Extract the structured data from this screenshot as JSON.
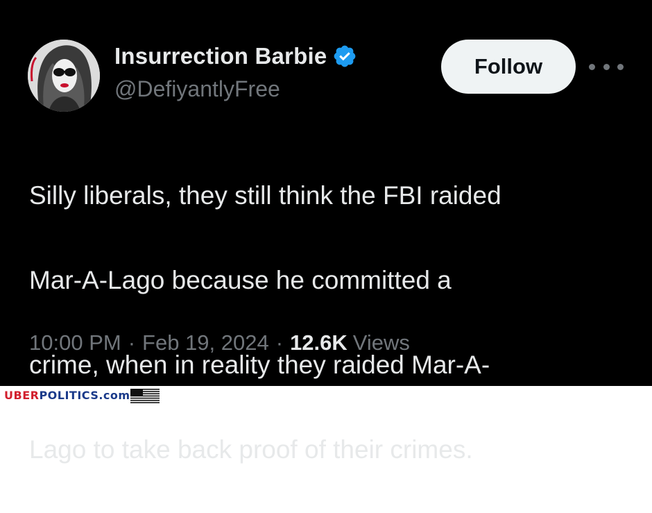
{
  "tweet": {
    "display_name": "Insurrection Barbie",
    "handle": "@DefiyantlyFree",
    "follow_label": "Follow",
    "text_lines": [
      "Silly liberals, they still think the FBI raided",
      "Mar-A-Lago because he committed a",
      "crime, when in reality they raided Mar-A-",
      "Lago to take back proof of their crimes."
    ],
    "time": "10:00 PM",
    "separator": "·",
    "date": "Feb 19, 2024",
    "views_count": "12.6K",
    "views_label": "Views"
  },
  "footer": {
    "brand_uber": "UBER",
    "brand_politics": "POLITICS",
    "brand_dotcom": ".com"
  },
  "icons": {
    "verified": "verified-badge-icon",
    "more": "more-options-icon",
    "flag": "us-flag-icon",
    "avatar": "avatar-image"
  },
  "colors": {
    "background": "#000000",
    "text_primary": "#e7e9ea",
    "text_secondary": "#71767b",
    "verified_blue": "#1d9bf0",
    "follow_button": "#eff3f4",
    "brand_red": "#d21f2d",
    "brand_blue": "#1a3a8a"
  }
}
